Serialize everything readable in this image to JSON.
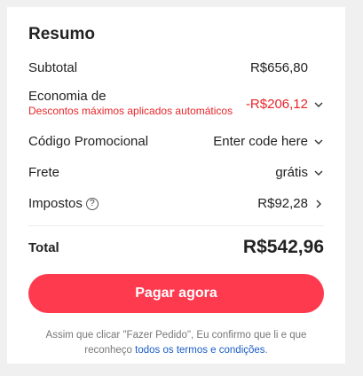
{
  "summary": {
    "title": "Resumo",
    "subtotal": {
      "label": "Subtotal",
      "value": "R$656,80"
    },
    "savings": {
      "label": "Economia de",
      "note": "Descontos máximos aplicados automáticos",
      "value": "-R$206,12"
    },
    "promo": {
      "label": "Código Promocional",
      "value": "Enter code here"
    },
    "shipping": {
      "label": "Frete",
      "value": "grátis"
    },
    "taxes": {
      "label": "Impostos",
      "help": "?",
      "value": "R$92,28"
    },
    "total": {
      "label": "Total",
      "value": "R$542,96"
    },
    "pay_button": "Pagar agora",
    "disclaimer_text": "Assim que clicar \"Fazer Pedido\", Eu confirmo que li e que reconheço",
    "disclaimer_link": "todos os termos e condições",
    "disclaimer_end": "."
  },
  "colors": {
    "accent": "#fe3a4f",
    "discount": "#e8262a",
    "link": "#1a5cc5"
  },
  "icons": {
    "expand": "chevron-down-icon",
    "navigate": "chevron-right-icon",
    "help": "question-circle-icon"
  }
}
